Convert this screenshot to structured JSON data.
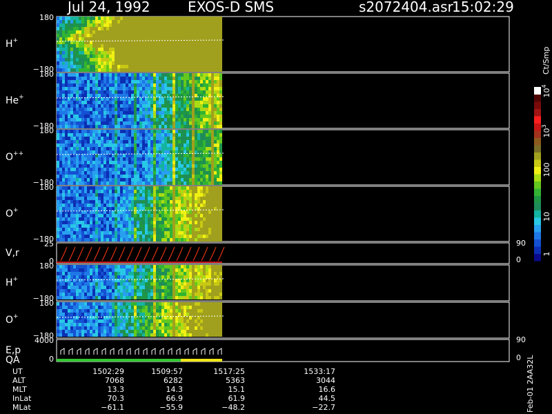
{
  "header": {
    "date": "Jul 24, 1992",
    "mission": "EXOS-D SMS",
    "file": "s2072404.asr",
    "time": "15:02:29"
  },
  "colorbar": {
    "unit": "Ct/Smp",
    "labels": [
      "1",
      "10",
      "100",
      "10",
      "10"
    ],
    "label_sup": [
      "",
      "",
      "",
      "3",
      "4"
    ],
    "colors": [
      "#0a0a8c",
      "#0b2fb4",
      "#1450d2",
      "#1e78e6",
      "#28a0f0",
      "#28c8e6",
      "#14b4a0",
      "#1e8c5a",
      "#1e9646",
      "#32b432",
      "#64c81e",
      "#aadc14",
      "#f0f014",
      "#c8c814",
      "#a0a01e",
      "#786e28",
      "#8c5a1e",
      "#a0321e",
      "#c81414",
      "#ff1e1e",
      "#a01414",
      "#780a0a",
      "#500505",
      "#ffffff"
    ]
  },
  "panels": [
    {
      "label": "H",
      "sup": "+",
      "ymax": "180",
      "ymin": "−180",
      "intensity": 0.75,
      "onset": 0.0
    },
    {
      "label": "He",
      "sup": "+",
      "ymax": "180",
      "ymin": "−180",
      "intensity": 0.45,
      "onset": 0.45
    },
    {
      "label": "O",
      "sup": "++",
      "ymax": "180",
      "ymin": "−180",
      "intensity": 0.4,
      "onset": 0.5
    },
    {
      "label": "O",
      "sup": "+",
      "ymax": "180",
      "ymin": "−180",
      "intensity": 0.55,
      "onset": 0.35
    },
    {
      "label": "V,r",
      "sup": "",
      "ymax": "25",
      "ymin": "0",
      "right_top": "90",
      "right_bottom": "0"
    },
    {
      "label": "H",
      "sup": "+",
      "ymax": "180",
      "ymin": "−180",
      "intensity": 0.45,
      "onset": 0.3
    },
    {
      "label": "O",
      "sup": "+",
      "ymax": "180",
      "ymin": "−180",
      "intensity": 0.5,
      "onset": 0.25
    },
    {
      "label": "E,p",
      "label2": "QA",
      "sup": "",
      "ymax": "4000",
      "ymin": "0",
      "right_top": "90",
      "right_bottom": "0"
    }
  ],
  "chart_data": {
    "type": "heatmap",
    "title": "Jul 24, 1992   EXOS-D SMS",
    "x_ticks": [
      "1502:29",
      "1509:57",
      "1517:25",
      "1533:17"
    ],
    "ephemeris": [
      {
        "name": "UT",
        "values": [
          "1502:29",
          "1509:57",
          "1517:25",
          "1533:17"
        ]
      },
      {
        "name": "ALT",
        "values": [
          "7068",
          "6282",
          "5363",
          "3044"
        ]
      },
      {
        "name": "MLT",
        "values": [
          "13.3",
          "14.3",
          "15.1",
          "16.6"
        ]
      },
      {
        "name": "InLat",
        "values": [
          "70.3",
          "66.9",
          "61.9",
          "44.5"
        ]
      },
      {
        "name": "MLat",
        "values": [
          "−61.1",
          "−55.9",
          "−48.2",
          "−22.7"
        ]
      }
    ],
    "colorbar_range": [
      1,
      10000
    ],
    "colorbar_scale": "log"
  },
  "footer_vertical": "Feb-01 2AA32L"
}
